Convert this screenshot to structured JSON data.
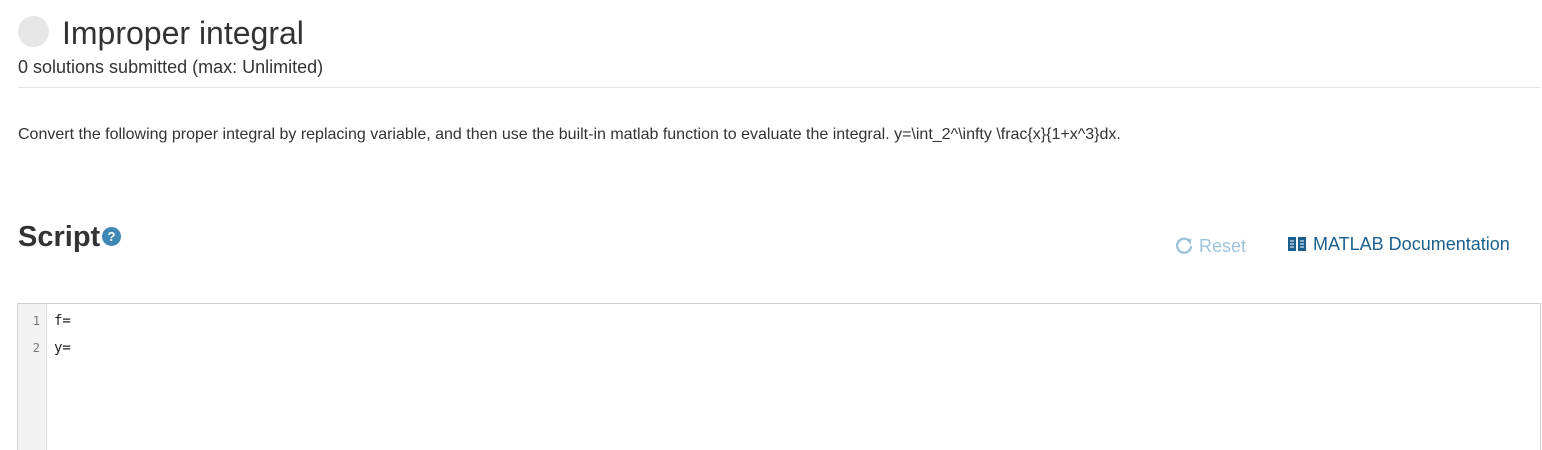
{
  "header": {
    "title": "Improper integral",
    "solutions": "0 solutions submitted (max: Unlimited)"
  },
  "problem": {
    "description": "Convert the following proper integral by replacing variable, and then use the built-in matlab function to evaluate the integral. y=\\int_2^\\infty \\frac{x}{1+x^3}dx."
  },
  "script": {
    "title": "Script",
    "help_glyph": "?",
    "reset_label": "Reset",
    "doc_label": "MATLAB Documentation"
  },
  "editor": {
    "lines": [
      {
        "number": "1",
        "code": "f="
      },
      {
        "number": "2",
        "code": "y="
      }
    ]
  },
  "colors": {
    "accent": "#3f88b5",
    "link": "#1a5f8f",
    "reset_disabled": "#9dc4dd"
  },
  "icons": {
    "status": "status-circle-icon",
    "help": "help-icon",
    "reset": "refresh-icon",
    "docs": "book-icon"
  }
}
